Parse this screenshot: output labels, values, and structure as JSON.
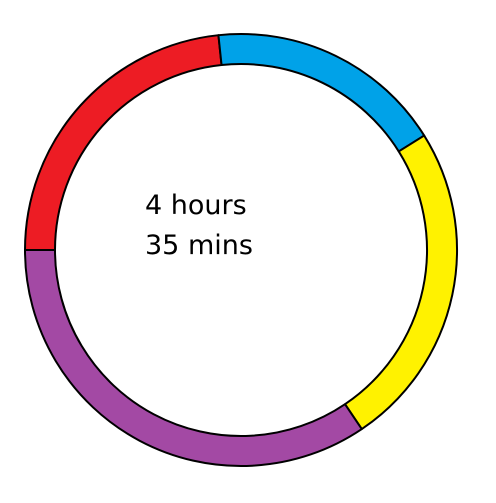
{
  "ring": {
    "segments": [
      {
        "name": "red",
        "color": "#ed1c24"
      },
      {
        "name": "blue",
        "color": "#00a2e8"
      },
      {
        "name": "yellow",
        "color": "#fff200"
      },
      {
        "name": "purple",
        "color": "#a349a4"
      }
    ],
    "outline_color": "#000000"
  },
  "center": {
    "line1": "4 hours",
    "line2": "35 mins"
  }
}
